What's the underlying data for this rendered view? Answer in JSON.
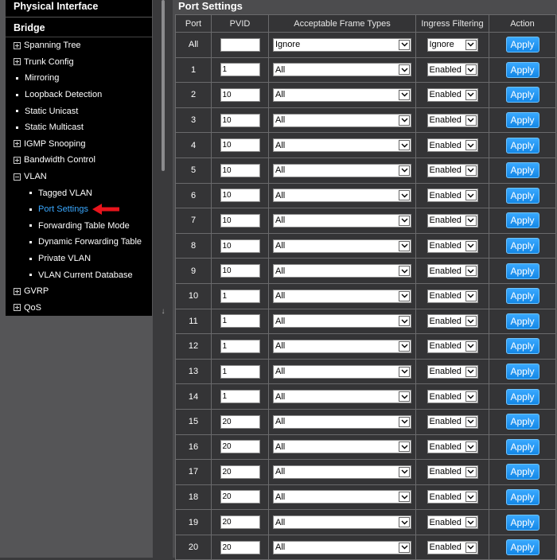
{
  "sidebar": {
    "header": "Physical Interface",
    "section": "Bridge",
    "items": [
      {
        "label": "Spanning Tree",
        "kind": "plus"
      },
      {
        "label": "Trunk Config",
        "kind": "plus"
      },
      {
        "label": "Mirroring",
        "kind": "bullet"
      },
      {
        "label": "Loopback Detection",
        "kind": "bullet"
      },
      {
        "label": "Static Unicast",
        "kind": "bullet"
      },
      {
        "label": "Static Multicast",
        "kind": "bullet"
      },
      {
        "label": "IGMP Snooping",
        "kind": "plus"
      },
      {
        "label": "Bandwidth Control",
        "kind": "plus"
      },
      {
        "label": "VLAN",
        "kind": "minus"
      },
      {
        "label": "Tagged VLAN",
        "kind": "sub"
      },
      {
        "label": "Port Settings",
        "kind": "sub",
        "active": true
      },
      {
        "label": "Forwarding Table Mode",
        "kind": "sub"
      },
      {
        "label": "Dynamic Forwarding Table",
        "kind": "sub"
      },
      {
        "label": "Private VLAN",
        "kind": "sub"
      },
      {
        "label": "VLAN Current Database",
        "kind": "sub"
      },
      {
        "label": "GVRP",
        "kind": "plus"
      },
      {
        "label": "QoS",
        "kind": "plus"
      }
    ],
    "active_color": "#3aa8ff",
    "arrow_color": "#e8141c"
  },
  "panel": {
    "title": "Port Settings",
    "columns": [
      "Port",
      "PVID",
      "Acceptable Frame Types",
      "Ingress Filtering",
      "Action"
    ],
    "apply_label": "Apply",
    "rows": [
      {
        "port": "All",
        "pvid": "",
        "frame": "Ignore",
        "ingress": "Ignore"
      },
      {
        "port": "1",
        "pvid": "1",
        "frame": "All",
        "ingress": "Enabled"
      },
      {
        "port": "2",
        "pvid": "10",
        "frame": "All",
        "ingress": "Enabled"
      },
      {
        "port": "3",
        "pvid": "10",
        "frame": "All",
        "ingress": "Enabled"
      },
      {
        "port": "4",
        "pvid": "10",
        "frame": "All",
        "ingress": "Enabled"
      },
      {
        "port": "5",
        "pvid": "10",
        "frame": "All",
        "ingress": "Enabled"
      },
      {
        "port": "6",
        "pvid": "10",
        "frame": "All",
        "ingress": "Enabled"
      },
      {
        "port": "7",
        "pvid": "10",
        "frame": "All",
        "ingress": "Enabled"
      },
      {
        "port": "8",
        "pvid": "10",
        "frame": "All",
        "ingress": "Enabled"
      },
      {
        "port": "9",
        "pvid": "10",
        "frame": "All",
        "ingress": "Enabled"
      },
      {
        "port": "10",
        "pvid": "1",
        "frame": "All",
        "ingress": "Enabled"
      },
      {
        "port": "11",
        "pvid": "1",
        "frame": "All",
        "ingress": "Enabled"
      },
      {
        "port": "12",
        "pvid": "1",
        "frame": "All",
        "ingress": "Enabled"
      },
      {
        "port": "13",
        "pvid": "1",
        "frame": "All",
        "ingress": "Enabled"
      },
      {
        "port": "14",
        "pvid": "1",
        "frame": "All",
        "ingress": "Enabled"
      },
      {
        "port": "15",
        "pvid": "20",
        "frame": "All",
        "ingress": "Enabled"
      },
      {
        "port": "16",
        "pvid": "20",
        "frame": "All",
        "ingress": "Enabled"
      },
      {
        "port": "17",
        "pvid": "20",
        "frame": "All",
        "ingress": "Enabled"
      },
      {
        "port": "18",
        "pvid": "20",
        "frame": "All",
        "ingress": "Enabled"
      },
      {
        "port": "19",
        "pvid": "20",
        "frame": "All",
        "ingress": "Enabled"
      },
      {
        "port": "20",
        "pvid": "20",
        "frame": "All",
        "ingress": "Enabled"
      }
    ]
  }
}
